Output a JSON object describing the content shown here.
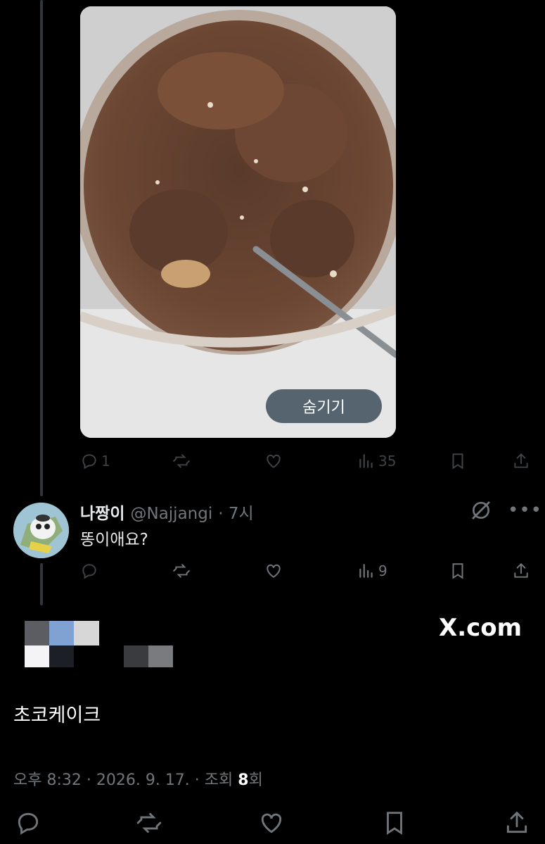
{
  "media": {
    "hide_label": "숨기기"
  },
  "first_post_actions": {
    "reply_count": "1",
    "retweet_count": "",
    "like_count": "",
    "views_count": "35"
  },
  "reply": {
    "name": "나짱이",
    "handle": "@Najjangi",
    "time": "· 7시",
    "text": "똥이애요?",
    "views_count": "9"
  },
  "brand": "X.com",
  "main_post": {
    "text": "초코케이크",
    "meta_prefix": "오후 8:32 · 2026. 9. 17. · 조회 ",
    "views": "8",
    "meta_suffix": "회"
  },
  "icons": [
    "reply-icon",
    "retweet-icon",
    "like-icon",
    "views-icon",
    "bookmark-icon",
    "share-icon",
    "grok-icon",
    "more-icon"
  ]
}
